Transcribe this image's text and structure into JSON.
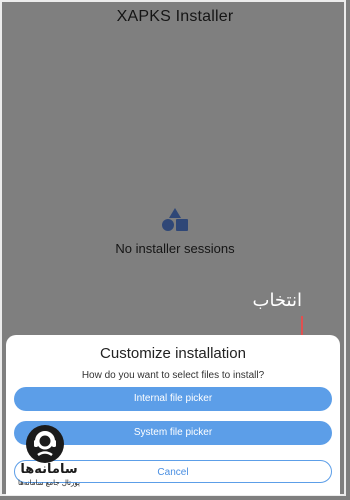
{
  "app": {
    "title": "XAPKS Installer"
  },
  "empty_state": {
    "icon": "shapes-icon",
    "text": "No installer sessions"
  },
  "annotation": {
    "text": "انتخاب",
    "color": "#ffffff",
    "arrow_color": "#e05050"
  },
  "sheet": {
    "title": "Customize installation",
    "question": "How do you want to select files to install?",
    "buttons": {
      "internal": "Internal file picker",
      "system": "System file picker",
      "cancel": "Cancel"
    },
    "accent_color": "#5c9ee8"
  },
  "watermark": {
    "name": "سامانه‌ها",
    "subtitle": "پورتال جامع سامانه‌ها"
  }
}
